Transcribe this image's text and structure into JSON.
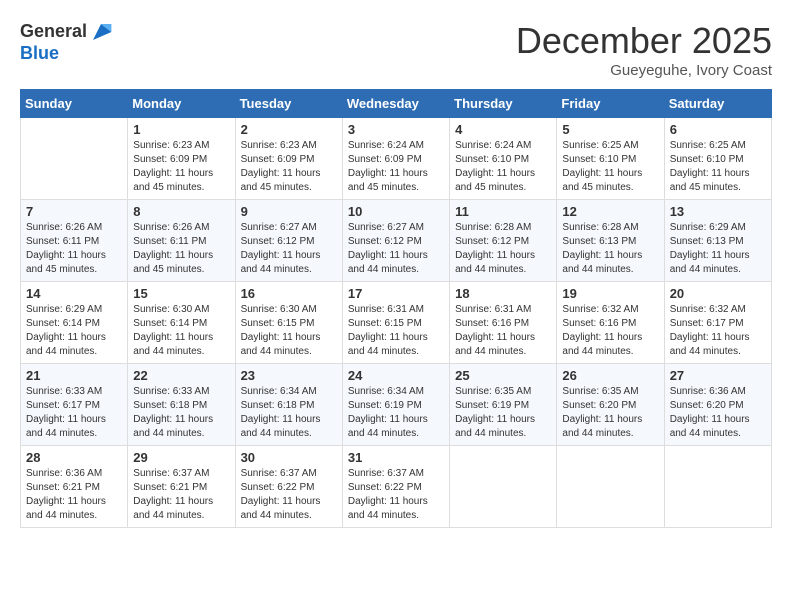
{
  "logo": {
    "general": "General",
    "blue": "Blue"
  },
  "title": "December 2025",
  "location": "Gueyeguhe, Ivory Coast",
  "days_of_week": [
    "Sunday",
    "Monday",
    "Tuesday",
    "Wednesday",
    "Thursday",
    "Friday",
    "Saturday"
  ],
  "weeks": [
    [
      {
        "day": "",
        "content": ""
      },
      {
        "day": "1",
        "content": "Sunrise: 6:23 AM\nSunset: 6:09 PM\nDaylight: 11 hours and 45 minutes."
      },
      {
        "day": "2",
        "content": "Sunrise: 6:23 AM\nSunset: 6:09 PM\nDaylight: 11 hours and 45 minutes."
      },
      {
        "day": "3",
        "content": "Sunrise: 6:24 AM\nSunset: 6:09 PM\nDaylight: 11 hours and 45 minutes."
      },
      {
        "day": "4",
        "content": "Sunrise: 6:24 AM\nSunset: 6:10 PM\nDaylight: 11 hours and 45 minutes."
      },
      {
        "day": "5",
        "content": "Sunrise: 6:25 AM\nSunset: 6:10 PM\nDaylight: 11 hours and 45 minutes."
      },
      {
        "day": "6",
        "content": "Sunrise: 6:25 AM\nSunset: 6:10 PM\nDaylight: 11 hours and 45 minutes."
      }
    ],
    [
      {
        "day": "7",
        "content": "Sunrise: 6:26 AM\nSunset: 6:11 PM\nDaylight: 11 hours and 45 minutes."
      },
      {
        "day": "8",
        "content": "Sunrise: 6:26 AM\nSunset: 6:11 PM\nDaylight: 11 hours and 45 minutes."
      },
      {
        "day": "9",
        "content": "Sunrise: 6:27 AM\nSunset: 6:12 PM\nDaylight: 11 hours and 44 minutes."
      },
      {
        "day": "10",
        "content": "Sunrise: 6:27 AM\nSunset: 6:12 PM\nDaylight: 11 hours and 44 minutes."
      },
      {
        "day": "11",
        "content": "Sunrise: 6:28 AM\nSunset: 6:12 PM\nDaylight: 11 hours and 44 minutes."
      },
      {
        "day": "12",
        "content": "Sunrise: 6:28 AM\nSunset: 6:13 PM\nDaylight: 11 hours and 44 minutes."
      },
      {
        "day": "13",
        "content": "Sunrise: 6:29 AM\nSunset: 6:13 PM\nDaylight: 11 hours and 44 minutes."
      }
    ],
    [
      {
        "day": "14",
        "content": "Sunrise: 6:29 AM\nSunset: 6:14 PM\nDaylight: 11 hours and 44 minutes."
      },
      {
        "day": "15",
        "content": "Sunrise: 6:30 AM\nSunset: 6:14 PM\nDaylight: 11 hours and 44 minutes."
      },
      {
        "day": "16",
        "content": "Sunrise: 6:30 AM\nSunset: 6:15 PM\nDaylight: 11 hours and 44 minutes."
      },
      {
        "day": "17",
        "content": "Sunrise: 6:31 AM\nSunset: 6:15 PM\nDaylight: 11 hours and 44 minutes."
      },
      {
        "day": "18",
        "content": "Sunrise: 6:31 AM\nSunset: 6:16 PM\nDaylight: 11 hours and 44 minutes."
      },
      {
        "day": "19",
        "content": "Sunrise: 6:32 AM\nSunset: 6:16 PM\nDaylight: 11 hours and 44 minutes."
      },
      {
        "day": "20",
        "content": "Sunrise: 6:32 AM\nSunset: 6:17 PM\nDaylight: 11 hours and 44 minutes."
      }
    ],
    [
      {
        "day": "21",
        "content": "Sunrise: 6:33 AM\nSunset: 6:17 PM\nDaylight: 11 hours and 44 minutes."
      },
      {
        "day": "22",
        "content": "Sunrise: 6:33 AM\nSunset: 6:18 PM\nDaylight: 11 hours and 44 minutes."
      },
      {
        "day": "23",
        "content": "Sunrise: 6:34 AM\nSunset: 6:18 PM\nDaylight: 11 hours and 44 minutes."
      },
      {
        "day": "24",
        "content": "Sunrise: 6:34 AM\nSunset: 6:19 PM\nDaylight: 11 hours and 44 minutes."
      },
      {
        "day": "25",
        "content": "Sunrise: 6:35 AM\nSunset: 6:19 PM\nDaylight: 11 hours and 44 minutes."
      },
      {
        "day": "26",
        "content": "Sunrise: 6:35 AM\nSunset: 6:20 PM\nDaylight: 11 hours and 44 minutes."
      },
      {
        "day": "27",
        "content": "Sunrise: 6:36 AM\nSunset: 6:20 PM\nDaylight: 11 hours and 44 minutes."
      }
    ],
    [
      {
        "day": "28",
        "content": "Sunrise: 6:36 AM\nSunset: 6:21 PM\nDaylight: 11 hours and 44 minutes."
      },
      {
        "day": "29",
        "content": "Sunrise: 6:37 AM\nSunset: 6:21 PM\nDaylight: 11 hours and 44 minutes."
      },
      {
        "day": "30",
        "content": "Sunrise: 6:37 AM\nSunset: 6:22 PM\nDaylight: 11 hours and 44 minutes."
      },
      {
        "day": "31",
        "content": "Sunrise: 6:37 AM\nSunset: 6:22 PM\nDaylight: 11 hours and 44 minutes."
      },
      {
        "day": "",
        "content": ""
      },
      {
        "day": "",
        "content": ""
      },
      {
        "day": "",
        "content": ""
      }
    ]
  ]
}
